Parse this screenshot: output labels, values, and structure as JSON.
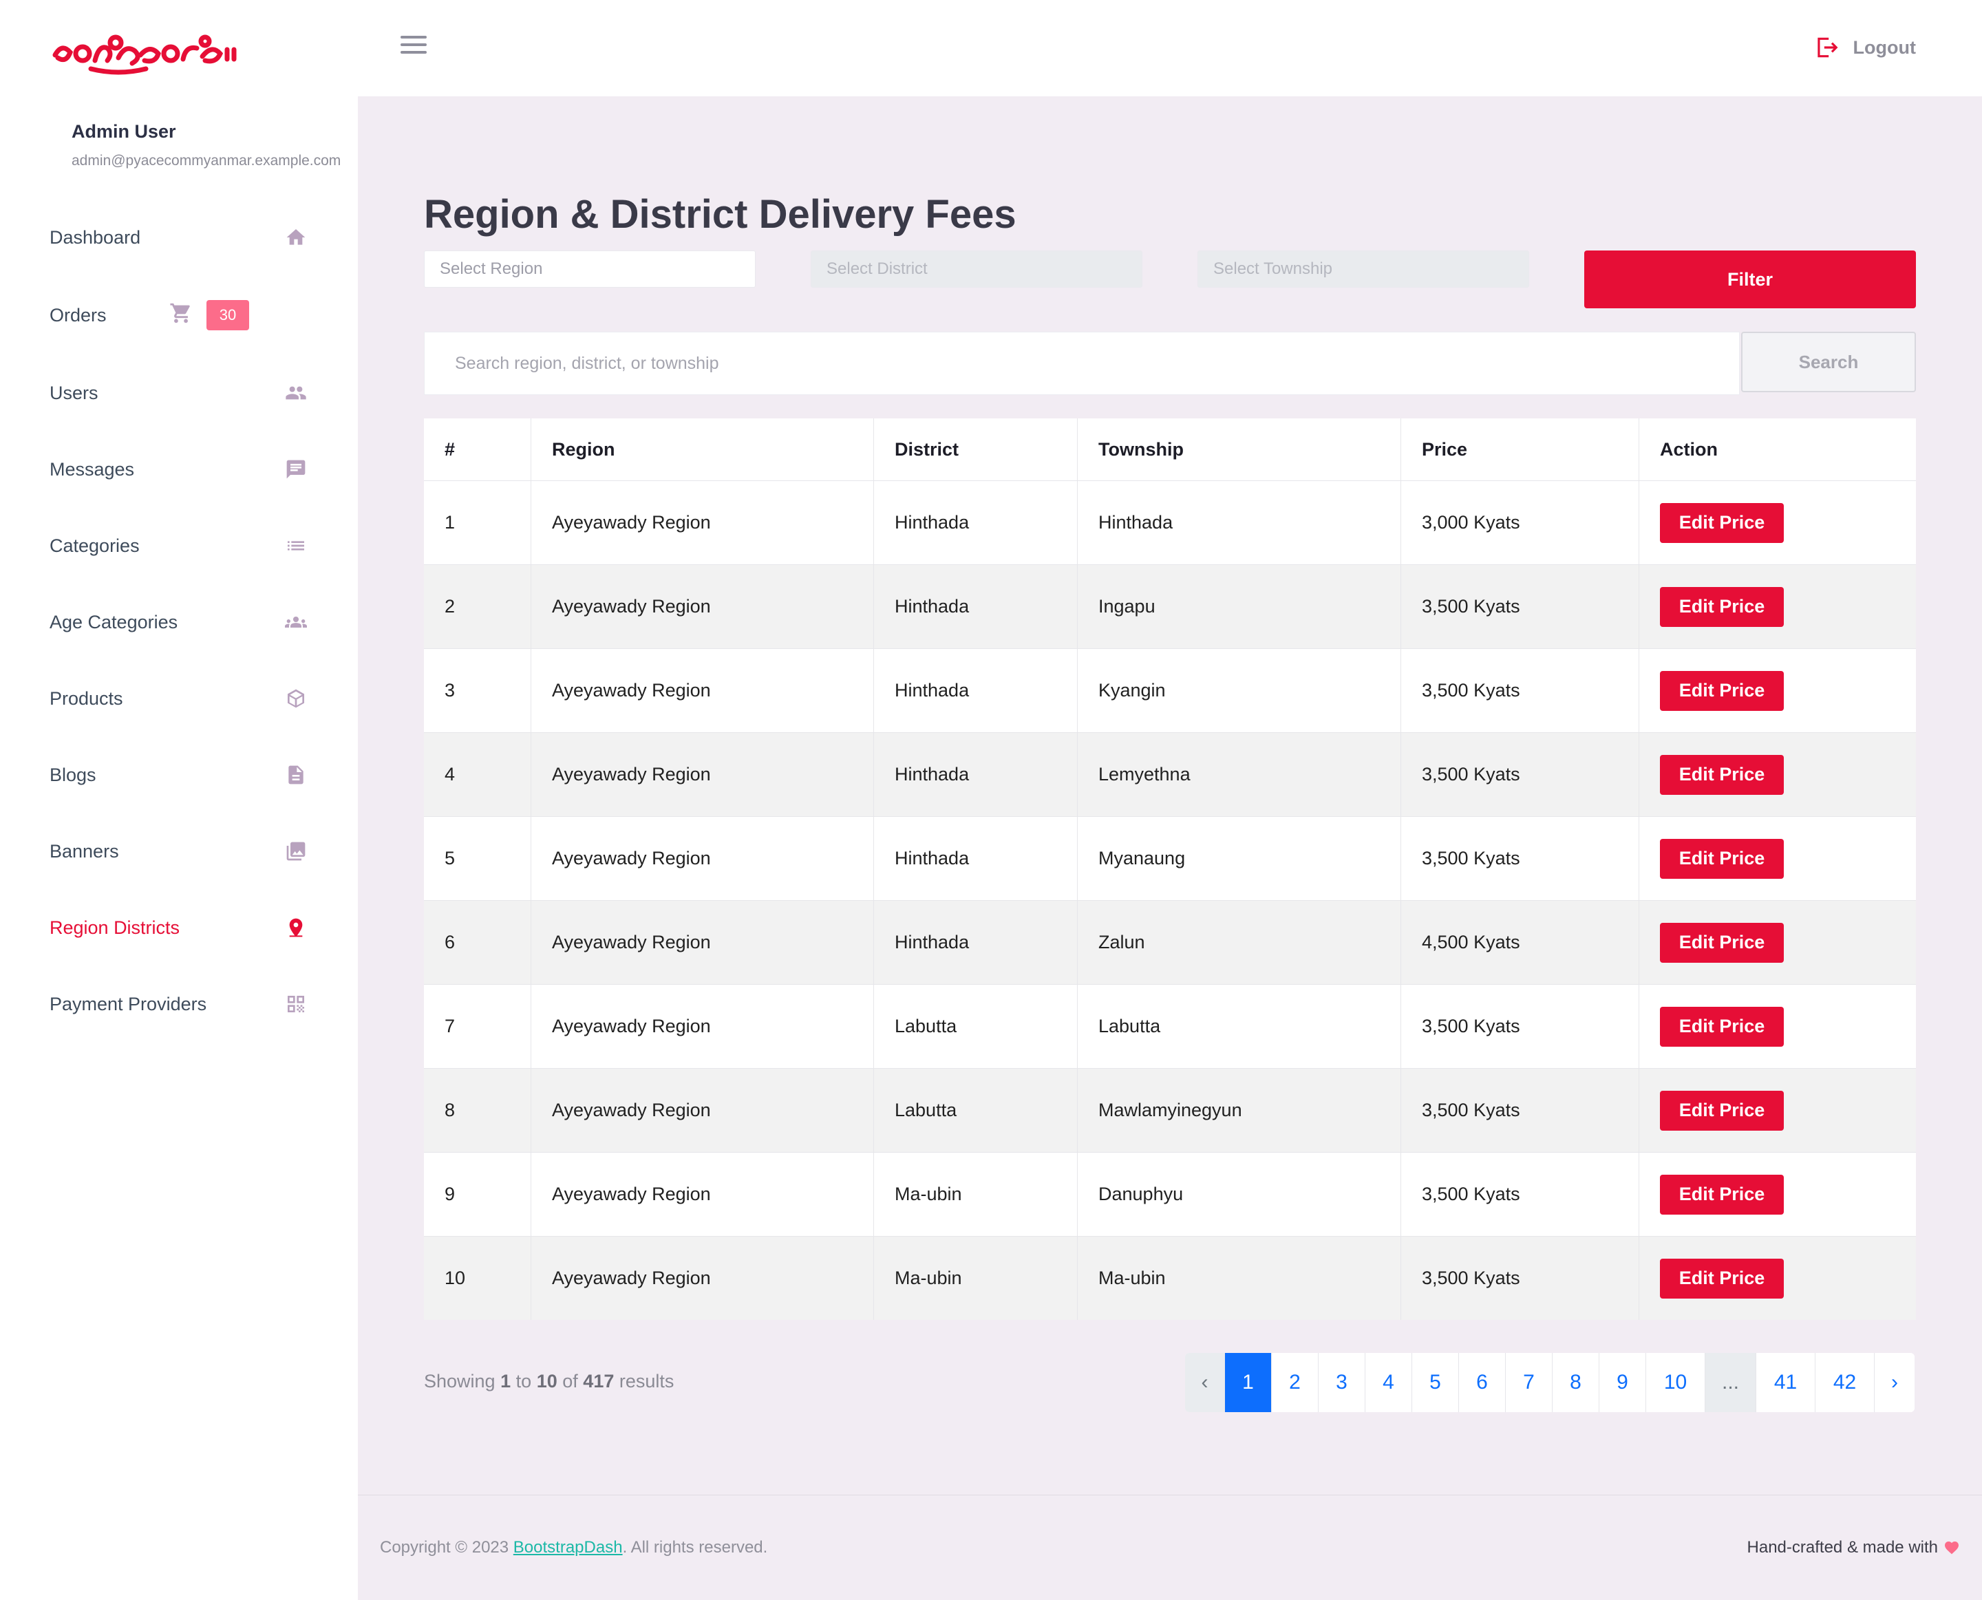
{
  "app": {
    "logo_text": "ဒေါ်ရွှေနွယ်ကြည်",
    "brand_color": "#e60e36"
  },
  "profile": {
    "name": "Admin User",
    "email": "admin@pyacecommyanmar.example.com"
  },
  "sidebar": {
    "items": [
      {
        "label": "Dashboard",
        "icon": "home-icon"
      },
      {
        "label": "Orders",
        "icon": "cart-icon",
        "badge": "30"
      },
      {
        "label": "Users",
        "icon": "users-icon"
      },
      {
        "label": "Messages",
        "icon": "message-icon"
      },
      {
        "label": "Categories",
        "icon": "list-icon"
      },
      {
        "label": "Age Categories",
        "icon": "group-icon"
      },
      {
        "label": "Products",
        "icon": "cube-icon"
      },
      {
        "label": "Blogs",
        "icon": "document-icon"
      },
      {
        "label": "Banners",
        "icon": "image-icon"
      },
      {
        "label": "Region Districts",
        "icon": "map-marker-icon",
        "active": true
      },
      {
        "label": "Payment Providers",
        "icon": "qrcode-icon"
      }
    ]
  },
  "topbar": {
    "logout_label": "Logout"
  },
  "main": {
    "title": "Region & District Delivery Fees",
    "filters": {
      "region_placeholder": "Select Region",
      "district_placeholder": "Select District",
      "township_placeholder": "Select Township",
      "filter_label": "Filter"
    },
    "search": {
      "placeholder": "Search region, district, or township",
      "button_label": "Search"
    },
    "table": {
      "headers": [
        "#",
        "Region",
        "District",
        "Township",
        "Price",
        "Action"
      ],
      "action_label": "Edit Price",
      "rows": [
        [
          "1",
          "Ayeyawady Region",
          "Hinthada",
          "Hinthada",
          "3,000 Kyats"
        ],
        [
          "2",
          "Ayeyawady Region",
          "Hinthada",
          "Ingapu",
          "3,500 Kyats"
        ],
        [
          "3",
          "Ayeyawady Region",
          "Hinthada",
          "Kyangin",
          "3,500 Kyats"
        ],
        [
          "4",
          "Ayeyawady Region",
          "Hinthada",
          "Lemyethna",
          "3,500 Kyats"
        ],
        [
          "5",
          "Ayeyawady Region",
          "Hinthada",
          "Myanaung",
          "3,500 Kyats"
        ],
        [
          "6",
          "Ayeyawady Region",
          "Hinthada",
          "Zalun",
          "4,500 Kyats"
        ],
        [
          "7",
          "Ayeyawady Region",
          "Labutta",
          "Labutta",
          "3,500 Kyats"
        ],
        [
          "8",
          "Ayeyawady Region",
          "Labutta",
          "Mawlamyinegyun",
          "3,500 Kyats"
        ],
        [
          "9",
          "Ayeyawady Region",
          "Ma-ubin",
          "Danuphyu",
          "3,500 Kyats"
        ],
        [
          "10",
          "Ayeyawady Region",
          "Ma-ubin",
          "Ma-ubin",
          "3,500 Kyats"
        ]
      ]
    },
    "showing": {
      "prefix": "Showing",
      "from": "1",
      "to_word": "to",
      "to": "10",
      "of_word": "of",
      "total": "417",
      "suffix": "results"
    },
    "pagination": {
      "prev": "‹",
      "next": "›",
      "pages": [
        "1",
        "2",
        "3",
        "4",
        "5",
        "6",
        "7",
        "8",
        "9",
        "10",
        "...",
        "41",
        "42"
      ],
      "current": "1"
    }
  },
  "footer": {
    "copyright_prefix": "Copyright © 2023",
    "link_text": "BootstrapDash",
    "copyright_suffix": ". All rights reserved.",
    "handcrafted": "Hand-crafted & made with"
  }
}
